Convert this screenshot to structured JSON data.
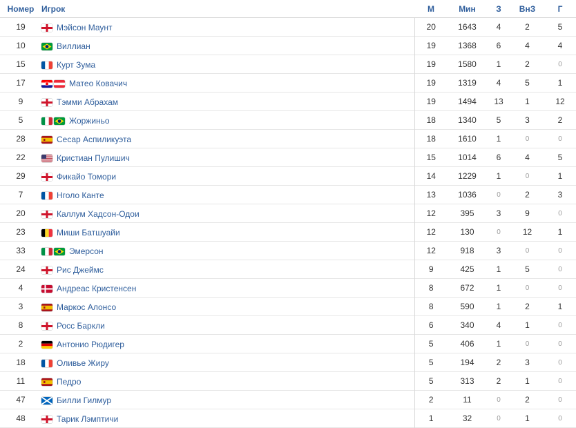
{
  "headers": {
    "number": "Номер",
    "player": "Игрок",
    "m": "М",
    "min": "Мин",
    "z": "З",
    "vnz": "ВнЗ",
    "g": "Г"
  },
  "rows": [
    {
      "number": "19",
      "name": "Мэйсон Маунт",
      "flags": [
        "england"
      ],
      "m": "20",
      "min": "1643",
      "z": "4",
      "vnz": "2",
      "g": "5"
    },
    {
      "number": "10",
      "name": "Виллиан",
      "flags": [
        "brazil"
      ],
      "m": "19",
      "min": "1368",
      "z": "6",
      "vnz": "4",
      "g": "4"
    },
    {
      "number": "15",
      "name": "Курт Зума",
      "flags": [
        "france"
      ],
      "m": "19",
      "min": "1580",
      "z": "1",
      "vnz": "2",
      "g": "0"
    },
    {
      "number": "17",
      "name": "Матео Ковачич",
      "flags": [
        "croatia",
        "austria"
      ],
      "m": "19",
      "min": "1319",
      "z": "4",
      "vnz": "5",
      "g": "1"
    },
    {
      "number": "9",
      "name": "Тэмми Абрахам",
      "flags": [
        "england"
      ],
      "m": "19",
      "min": "1494",
      "z": "13",
      "vnz": "1",
      "g": "12"
    },
    {
      "number": "5",
      "name": "Жоржиньо",
      "flags": [
        "italy",
        "brazil"
      ],
      "m": "18",
      "min": "1340",
      "z": "5",
      "vnz": "3",
      "g": "2"
    },
    {
      "number": "28",
      "name": "Сесар Аспиликуэта",
      "flags": [
        "spain"
      ],
      "m": "18",
      "min": "1610",
      "z": "1",
      "vnz": "0",
      "g": "0"
    },
    {
      "number": "22",
      "name": "Кристиан Пулишич",
      "flags": [
        "usa"
      ],
      "m": "15",
      "min": "1014",
      "z": "6",
      "vnz": "4",
      "g": "5"
    },
    {
      "number": "29",
      "name": "Фикайо Томори",
      "flags": [
        "england"
      ],
      "m": "14",
      "min": "1229",
      "z": "1",
      "vnz": "0",
      "g": "1"
    },
    {
      "number": "7",
      "name": "Нголо Канте",
      "flags": [
        "france"
      ],
      "m": "13",
      "min": "1036",
      "z": "0",
      "vnz": "2",
      "g": "3"
    },
    {
      "number": "20",
      "name": "Каллум Хадсон-Одои",
      "flags": [
        "england"
      ],
      "m": "12",
      "min": "395",
      "z": "3",
      "vnz": "9",
      "g": "0"
    },
    {
      "number": "23",
      "name": "Миши Батшуайи",
      "flags": [
        "belgium"
      ],
      "m": "12",
      "min": "130",
      "z": "0",
      "vnz": "12",
      "g": "1"
    },
    {
      "number": "33",
      "name": "Эмерсон",
      "flags": [
        "italy",
        "brazil"
      ],
      "m": "12",
      "min": "918",
      "z": "3",
      "vnz": "0",
      "g": "0"
    },
    {
      "number": "24",
      "name": "Рис Джеймс",
      "flags": [
        "england"
      ],
      "m": "9",
      "min": "425",
      "z": "1",
      "vnz": "5",
      "g": "0"
    },
    {
      "number": "4",
      "name": "Андреас Кристенсен",
      "flags": [
        "denmark"
      ],
      "m": "8",
      "min": "672",
      "z": "1",
      "vnz": "0",
      "g": "0"
    },
    {
      "number": "3",
      "name": "Маркос Алонсо",
      "flags": [
        "spain"
      ],
      "m": "8",
      "min": "590",
      "z": "1",
      "vnz": "2",
      "g": "1"
    },
    {
      "number": "8",
      "name": "Росс Баркли",
      "flags": [
        "england"
      ],
      "m": "6",
      "min": "340",
      "z": "4",
      "vnz": "1",
      "g": "0"
    },
    {
      "number": "2",
      "name": "Антонио Рюдигер",
      "flags": [
        "germany"
      ],
      "m": "5",
      "min": "406",
      "z": "1",
      "vnz": "0",
      "g": "0"
    },
    {
      "number": "18",
      "name": "Оливье Жиру",
      "flags": [
        "france"
      ],
      "m": "5",
      "min": "194",
      "z": "2",
      "vnz": "3",
      "g": "0"
    },
    {
      "number": "11",
      "name": "Педро",
      "flags": [
        "spain"
      ],
      "m": "5",
      "min": "313",
      "z": "2",
      "vnz": "1",
      "g": "0"
    },
    {
      "number": "47",
      "name": "Билли Гилмур",
      "flags": [
        "scotland"
      ],
      "m": "2",
      "min": "11",
      "z": "0",
      "vnz": "2",
      "g": "0"
    },
    {
      "number": "48",
      "name": "Тарик Лэмптичи",
      "flags": [
        "england"
      ],
      "m": "1",
      "min": "32",
      "z": "0",
      "vnz": "1",
      "g": "0"
    }
  ]
}
